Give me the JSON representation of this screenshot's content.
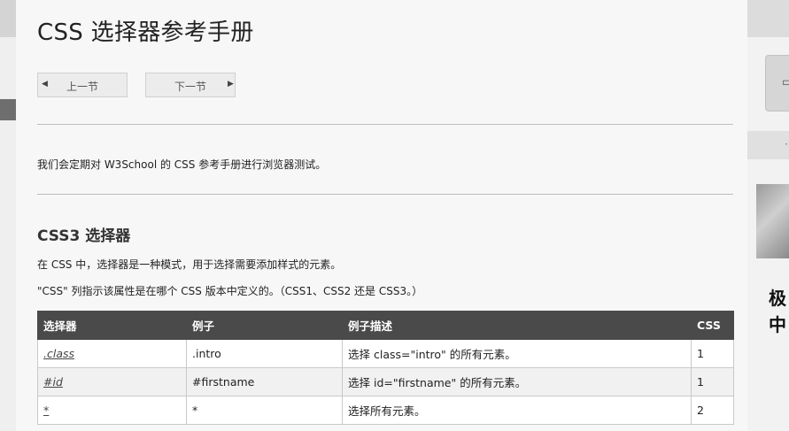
{
  "page": {
    "title": "CSS 选择器参考手册",
    "nav": {
      "prev_label": "上一节",
      "next_label": "下一节"
    },
    "intro": "我们会定期对 W3School 的 CSS 参考手册进行浏览器测试。",
    "section_heading": "CSS3 选择器",
    "paragraphs": [
      "在 CSS 中，选择器是一种模式，用于选择需要添加样式的元素。",
      "\"CSS\" 列指示该属性是在哪个 CSS 版本中定义的。（CSS1、CSS2 还是 CSS3。）"
    ]
  },
  "table": {
    "headers": [
      "选择器",
      "例子",
      "例子描述",
      "CSS"
    ],
    "rows": [
      {
        "selector": ".class",
        "example": ".intro",
        "description": "选择 class=\"intro\" 的所有元素。",
        "css": "1"
      },
      {
        "selector": "#id",
        "example": "#firstname",
        "description": "选择 id=\"firstname\" 的所有元素。",
        "css": "1"
      },
      {
        "selector": "*",
        "example": "*",
        "description": "选择所有元素。",
        "css": "2"
      }
    ]
  },
  "sidebar": {
    "ad_title": "极中"
  },
  "icons": {
    "prev": "triangle-left-icon",
    "next": "triangle-right-icon"
  }
}
